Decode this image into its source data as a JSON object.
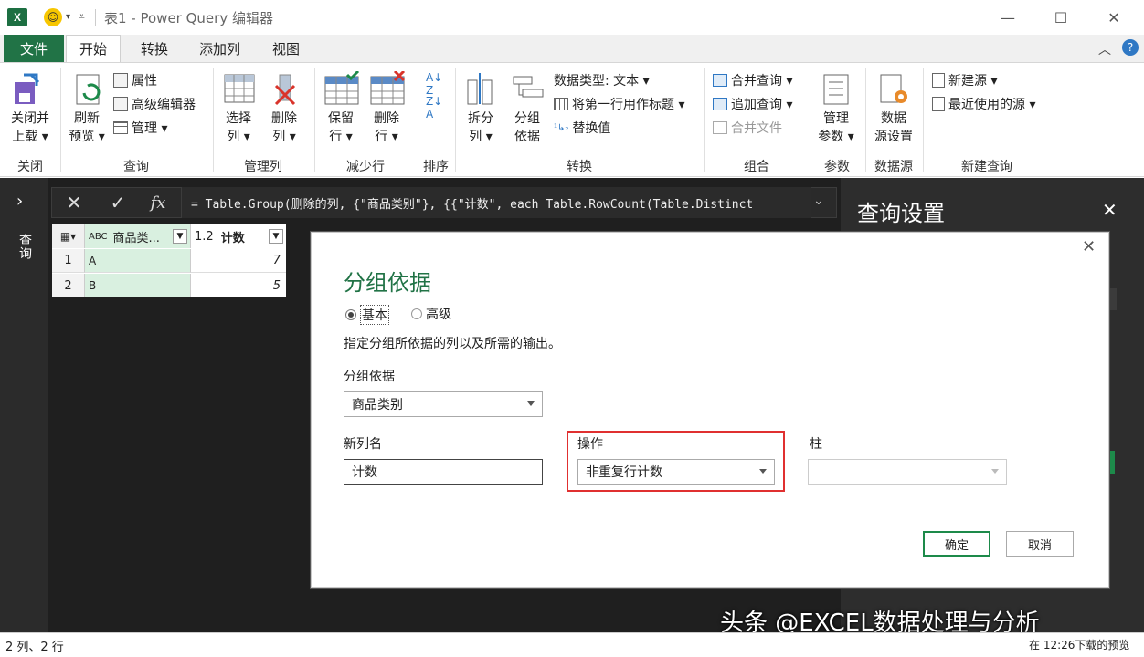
{
  "titlebar": {
    "app_logo": "X",
    "title": "表1 - Power Query 编辑器"
  },
  "tabs": [
    "文件",
    "开始",
    "转换",
    "添加列",
    "视图"
  ],
  "ribbon": {
    "groups": {
      "close": "关闭",
      "query": "查询",
      "manage_cols": "管理列",
      "reduce_rows": "减少行",
      "sort": "排序",
      "transform": "转换",
      "combine": "组合",
      "params": "参数",
      "datasource": "数据源",
      "new_query": "新建查询"
    },
    "close_load": [
      "关闭并",
      "上载 ▾"
    ],
    "refresh": [
      "刷新",
      "预览 ▾"
    ],
    "properties": "属性",
    "advanced_editor": "高级编辑器",
    "manage": "管理 ▾",
    "choose_cols": [
      "选择",
      "列 ▾"
    ],
    "remove_cols": [
      "删除",
      "列 ▾"
    ],
    "keep_rows": [
      "保留",
      "行 ▾"
    ],
    "remove_rows": [
      "删除",
      "行 ▾"
    ],
    "split_col": [
      "拆分",
      "列 ▾"
    ],
    "group_by": [
      "分组",
      "依据"
    ],
    "data_type": "数据类型: 文本 ▾",
    "first_row_header": "将第一行用作标题 ▾",
    "replace_values": "替换值",
    "merge_queries": "合并查询 ▾",
    "append_queries": "追加查询 ▾",
    "combine_files": "合并文件",
    "manage_params": [
      "管理",
      "参数 ▾"
    ],
    "ds_settings": [
      "数据",
      "源设置"
    ],
    "new_source": "新建源 ▾",
    "recent_sources": "最近使用的源 ▾"
  },
  "sidebar": {
    "label": "查询"
  },
  "formula": {
    "text": "= Table.Group(删除的列, {\"商品类别\"}, {{\"计数\", each Table.RowCount(Table.Distinct"
  },
  "table": {
    "headers": [
      {
        "type": "ABC",
        "name": "商品类..."
      },
      {
        "type": "1.2",
        "name": "计数"
      }
    ],
    "rows": [
      {
        "num": "1",
        "cat": "A",
        "count": "7"
      },
      {
        "num": "2",
        "cat": "B",
        "count": "5"
      }
    ]
  },
  "right_panel": {
    "title": "查询设置"
  },
  "dialog": {
    "title": "分组依据",
    "radio_basic": "基本",
    "radio_advanced": "高级",
    "description": "指定分组所依据的列以及所需的输出。",
    "group_by_label": "分组依据",
    "group_by_value": "商品类别",
    "new_col_label": "新列名",
    "new_col_value": "计数",
    "operation_label": "操作",
    "operation_value": "非重复行计数",
    "column_label": "柱",
    "column_value": "",
    "ok": "确定",
    "cancel": "取消",
    "highlight_color": "#e03030"
  },
  "statusbar": {
    "left": "2 列、2 行",
    "right": "在 12:26下载的预览"
  },
  "watermark": "头条 @EXCEL数据处理与分析",
  "colors": {
    "excel_green": "#217346",
    "selected_col": "#d9f0e0"
  }
}
